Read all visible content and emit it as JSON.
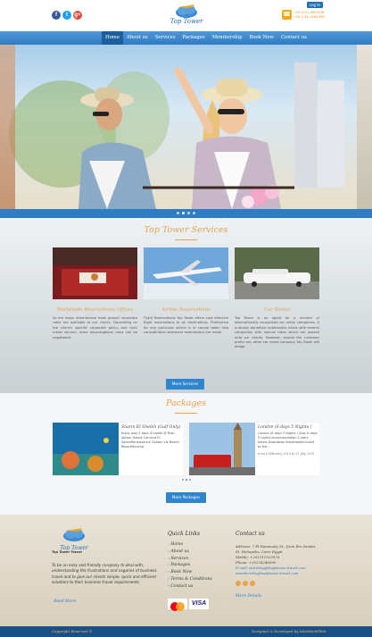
{
  "header": {
    "social": [
      {
        "icon": "facebook-icon",
        "glyph": "f",
        "color": "#3b5998"
      },
      {
        "icon": "twitter-icon",
        "glyph": "t",
        "color": "#1da1f2"
      },
      {
        "icon": "google-plus-icon",
        "glyph": "g+",
        "color": "#dd4b39"
      }
    ],
    "logo_text": "Top Tower",
    "login_label": "Log In",
    "phone_lines": [
      "+20-0111-0523978",
      "+20-2-24-1246-990"
    ]
  },
  "nav": {
    "items": [
      "Home",
      "About us",
      "Services",
      "Packages",
      "Membership",
      "Book Now",
      "Contact us"
    ],
    "active": 0
  },
  "slider": {
    "dots": 4,
    "active_dot": 1
  },
  "services": {
    "title": "Top Tower Services",
    "button_label": "More Services",
    "cards": [
      {
        "title": "Worldwide Reservations Offices",
        "text": "As the major international hotel groups' corporate rates are available to our clients. Depending on the client's specific corporate policy and their travel volume, more advantageous rates can be negotiated."
      },
      {
        "title": "Airline Reservations",
        "text": "Flight Reservations Top Tower offers cost effective flight reservations to all destinations. Preference for any particular airline is of course taken into consideration whenever reservations are made."
      },
      {
        "title": "Car Rental",
        "text": "Top Tower is an agent for a number of internationally recognized car rental companies. A mutually beneficial relationship exists with several companies with special rates which are passed onto our clients. However, should the customer prefer any other car rental company Top Tower will oblige."
      }
    ]
  },
  "packages": {
    "title": "Packages",
    "button_label": "More Packages",
    "dots": 3,
    "active_dot": 1,
    "items": [
      {
        "name": "Sharm El Sheikh (Gulf Only)",
        "desc": "Enjoy stay 5 days 4 nights @ Rixo Aktam Hotels Concord El SalamRenaissance Golden Vie Beach ResortMovang",
        "date": ""
      },
      {
        "name": "London (6 days 5 Nights )",
        "desc": "London (6 days 5 Nights ) Stay 6 days 5 nights accommodation 4 stars hotels Downtown Breakfastincluded to the...",
        "date": "from 6 February 2019 to 31 July 2019"
      }
    ]
  },
  "footer": {
    "logo_text": "Top Tower",
    "tagline": "Top Tower Travel",
    "about": "To be an easy and friendly company to deal with, understanding the frustrations and vagaries of business travel and to give our clients simple, quick and efficient solutions to their business travel requirements.",
    "read_more": "Read More",
    "quick_links_title": "Quick Links",
    "quick_links": [
      "Home",
      "About us",
      "Services",
      "Packages",
      "Book Now",
      "Terms & Conditions",
      "Contact us"
    ],
    "contact_title": "Contact us",
    "contact_lines": [
      "Address: 7 El Hamouaty St., from Ibn Sandar",
      "St. Heliopolis, Cairo Egypt",
      "Mobile: +201111523978",
      "Phone: +20224246990",
      "E-mail: ticketing@topptower.travel.com",
      "membership@topptower.travel.com"
    ],
    "more_details": "More Details",
    "payment": [
      {
        "icon": "mastercard-icon",
        "label": "MC"
      },
      {
        "icon": "visa-icon",
        "label": "VISA"
      }
    ],
    "copyright_left": "Copyright Reserved ©",
    "copyright_right": "Designed & Developed by IdeaWorldWeb"
  },
  "colors": {
    "nav_blue": "#2f7cc3",
    "accent_orange": "#e8a24b",
    "footer_bar": "#1a4f86"
  }
}
